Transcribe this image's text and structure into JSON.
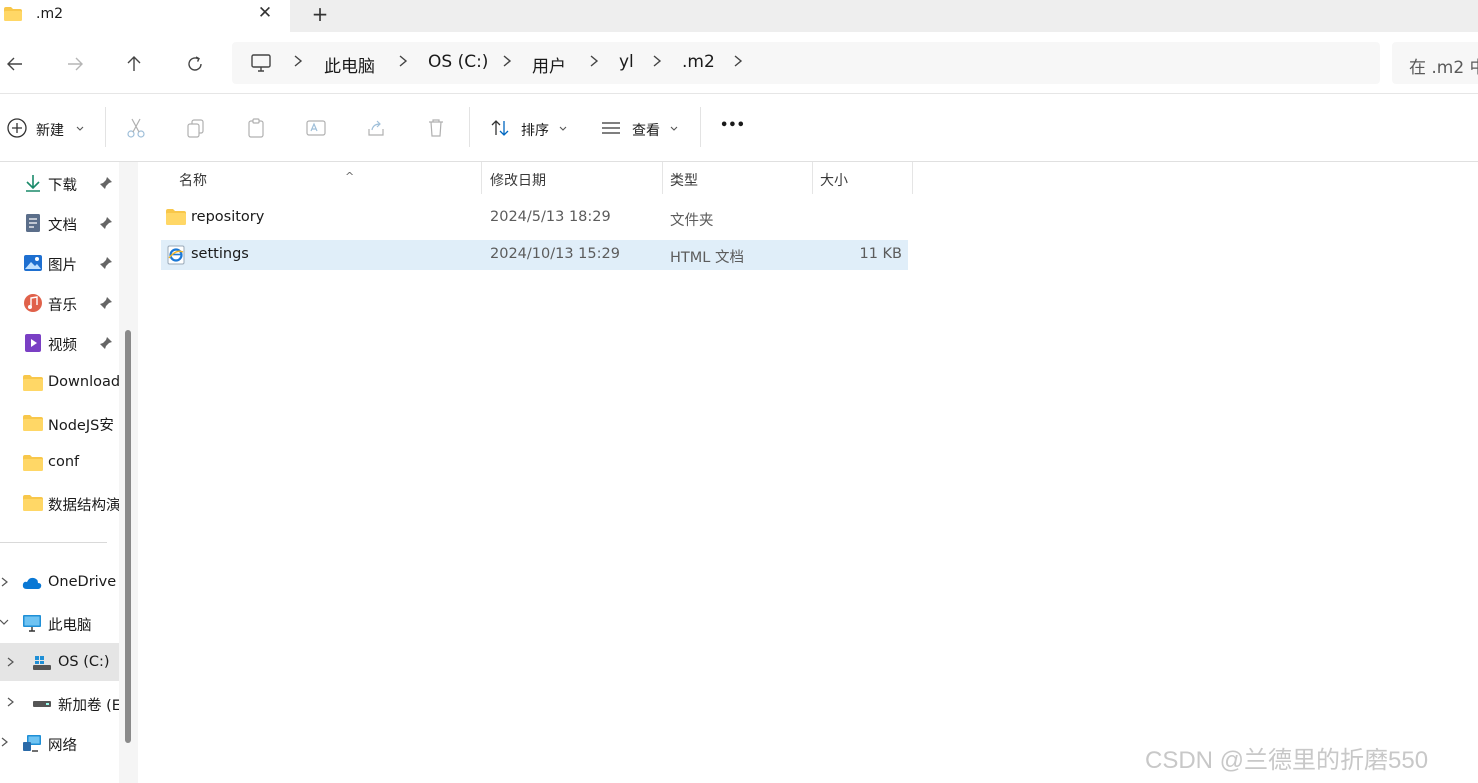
{
  "tab": {
    "title": ".m2",
    "close_glyph": "✕",
    "new_glyph": "+"
  },
  "breadcrumb": [
    "此电脑",
    "OS (C:)",
    "用户",
    "yl",
    ".m2"
  ],
  "search": {
    "placeholder": "在 .m2 中"
  },
  "toolbar": {
    "new_label": "新建",
    "sort_label": "排序",
    "view_label": "查看",
    "more_glyph": "•••"
  },
  "sidebar": {
    "quick": [
      {
        "label": "下载",
        "icon": "download-icon",
        "pinned": true
      },
      {
        "label": "文档",
        "icon": "document-icon",
        "pinned": true
      },
      {
        "label": "图片",
        "icon": "pictures-icon",
        "pinned": true
      },
      {
        "label": "音乐",
        "icon": "music-icon",
        "pinned": true
      },
      {
        "label": "视频",
        "icon": "video-icon",
        "pinned": true
      },
      {
        "label": "Download",
        "icon": "folder-icon",
        "pinned": false
      },
      {
        "label": "NodeJS安",
        "icon": "folder-icon",
        "pinned": false
      },
      {
        "label": "conf",
        "icon": "folder-icon",
        "pinned": false
      },
      {
        "label": "数据结构演",
        "icon": "folder-icon",
        "pinned": false
      }
    ],
    "tree": [
      {
        "label": "OneDrive",
        "icon": "cloud-icon"
      },
      {
        "label": "此电脑",
        "icon": "computer-icon"
      },
      {
        "label": "OS (C:)",
        "icon": "drive-icon",
        "selected": true
      },
      {
        "label": "新加卷 (E",
        "icon": "drive-icon"
      },
      {
        "label": "网络",
        "icon": "network-icon"
      }
    ]
  },
  "columns": {
    "name": "名称",
    "modified": "修改日期",
    "type": "类型",
    "size": "大小"
  },
  "files": [
    {
      "name": "repository",
      "modified": "2024/5/13 18:29",
      "type": "文件夹",
      "size": "",
      "icon": "folder-icon"
    },
    {
      "name": "settings",
      "modified": "2024/10/13 15:29",
      "type": "HTML 文档",
      "size": "11 KB",
      "icon": "html-file-icon",
      "selected": true
    }
  ],
  "watermark": "CSDN @兰德里的折磨550",
  "colors": {
    "accent": "#0067c0",
    "folder": "#f8c74a",
    "selection": "#e0eef9"
  }
}
